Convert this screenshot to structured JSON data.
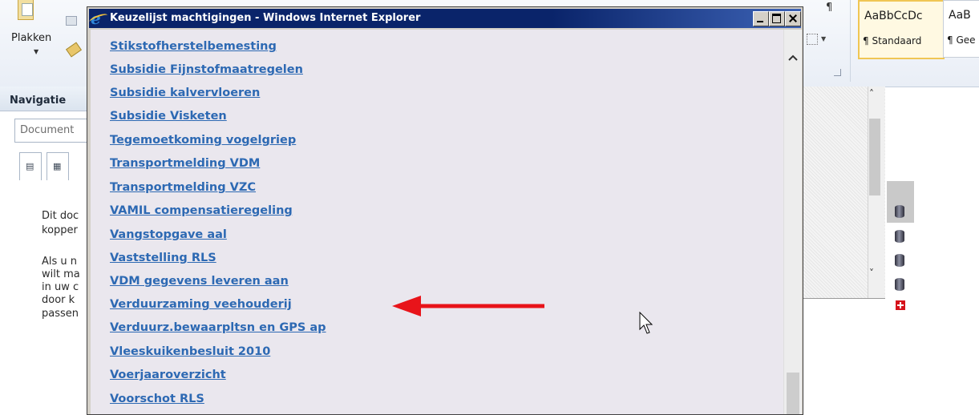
{
  "word": {
    "paste_label": "Plakken",
    "navigation_title": "Navigatie",
    "search_placeholder": "Document",
    "nav_text_lines": [
      "Dit doc",
      "kopper",
      "Als u n",
      "wilt ma",
      "in uw c",
      "door k",
      "passen"
    ],
    "para_mark": "¶",
    "styles": [
      {
        "sample": "AaBbCcDc",
        "name": "¶ Standaard"
      },
      {
        "sample": "AaB",
        "name": "¶ Gee"
      }
    ]
  },
  "popup": {
    "title": "Keuzelijst machtigingen - Windows Internet Explorer",
    "links": [
      "Stikstofherstelbemesting",
      "Subsidie Fijnstofmaatregelen",
      "Subsidie kalvervloeren",
      "Subsidie Visketen",
      "Tegemoetkoming vogelgriep",
      "Transportmelding VDM",
      "Transportmelding VZC",
      "VAMIL compensatieregeling",
      "Vangstopgave aal",
      "Vaststelling RLS",
      "VDM gegevens leveren aan",
      "Verduurzaming veehouderij",
      "Verduurz.bewaarpltsn en GPS ap",
      "Vleeskuikenbesluit 2010",
      "Voerjaaroverzicht",
      "Voorschot RLS"
    ],
    "highlighted_link": "VDM gegevens leveren aan"
  },
  "colors": {
    "link": "#2d69b3",
    "titlebar": "#0a246a",
    "arrow": "#e8141a",
    "content_bg": "#eae7ee"
  },
  "icons": [
    "ie-logo-icon",
    "minimize-icon",
    "maximize-icon",
    "close-icon",
    "scroll-up-icon",
    "scroll-down-icon",
    "database-icon",
    "add-icon",
    "paste-icon",
    "copy-icon",
    "format-painter-icon",
    "mouse-cursor-icon",
    "red-arrow-annotation"
  ]
}
